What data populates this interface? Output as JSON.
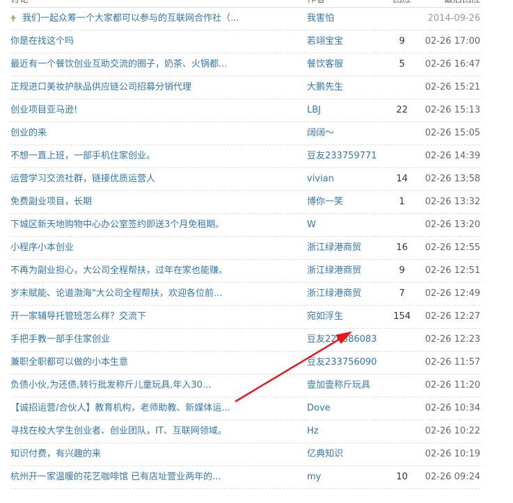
{
  "header": {
    "col_title": "讨论",
    "col_author": "作者",
    "col_reply": "回应",
    "col_time": "最后回应"
  },
  "topics": [
    {
      "title": "我们一起众筹一个大家都可以参与的互联网合作社（...",
      "author": "我害怕",
      "replies": "",
      "time": "2014-09-26",
      "pinned": true
    },
    {
      "title": "你是在找这个吗",
      "author": "若翊宝宝",
      "replies": "9",
      "time": "02-26 17:00"
    },
    {
      "title": "最近有一个餐饮创业互助交流的圈子，奶茶、火锅都...",
      "author": "餐饮客服",
      "replies": "5",
      "time": "02-26 16:47"
    },
    {
      "title": "正规进口美妆护肤品供应链公司招募分销代理",
      "author": "大鹏先生",
      "replies": "",
      "time": "02-26 15:21"
    },
    {
      "title": "创业项目亚马逊!",
      "author": "LBJ",
      "replies": "22",
      "time": "02-26 15:13"
    },
    {
      "title": "创业的来",
      "author": "阔阔～",
      "replies": "",
      "time": "02-26 15:05"
    },
    {
      "title": "不想一直上班，一部手机住家创业。",
      "author": "豆友233759771",
      "replies": "",
      "time": "02-26 14:39"
    },
    {
      "title": "运营学习交流社群，链接优质运营人",
      "author": "vivian",
      "replies": "14",
      "time": "02-26 13:58"
    },
    {
      "title": "免费副业项目，长期",
      "author": "博你一笑",
      "replies": "1",
      "time": "02-26 13:32"
    },
    {
      "title": "下城区新天地购物中心办公室签约即送3个月免租期。",
      "author": "W",
      "replies": "",
      "time": "02-26 13:20"
    },
    {
      "title": "小程序小本创业",
      "author": "浙江绿港商贸",
      "replies": "16",
      "time": "02-26 12:55"
    },
    {
      "title": "不再为副业担心，大公司全程帮扶，过年在家也能赚。",
      "author": "浙江绿港商贸",
      "replies": "9",
      "time": "02-26 12:51"
    },
    {
      "title": "岁末赋能、论道渤海\"大公司全程帮扶，欢迎各位前...",
      "author": "浙江绿港商贸",
      "replies": "7",
      "time": "02-26 12:49"
    },
    {
      "title": "开一家辅导托管班怎么样？交流下",
      "author": "宛如浮生",
      "replies": "154",
      "time": "02-26 12:27"
    },
    {
      "title": "手把手教一部手住家创业",
      "author": "豆友224886083",
      "replies": "",
      "time": "02-26 12:23"
    },
    {
      "title": "兼职全职都可以做的小本生意",
      "author": "豆友233756090",
      "replies": "",
      "time": "02-26 11:57"
    },
    {
      "title": "负债小伙,为还债,转行批发称斤儿童玩具,年入30...",
      "author": "壹加壹称斤玩具",
      "replies": "",
      "time": "02-26 11:20"
    },
    {
      "title": "【诚招运营/合伙人】教育机构，老师助教、新媒体运...",
      "author": "Dove",
      "replies": "",
      "time": "02-26 10:34"
    },
    {
      "title": "寻找在校大学生创业者、创业团队，IT、互联网领域。",
      "author": "Hz",
      "replies": "",
      "time": "02-26 10:22"
    },
    {
      "title": "知识付费，有兴趣的来",
      "author": "亿典知识",
      "replies": "",
      "time": "02-26 10:19"
    },
    {
      "title": "杭州开一家温暖的花艺咖啡馆 已有店址营业两年的...",
      "author": "my",
      "replies": "10",
      "time": "02-26 09:24"
    }
  ],
  "annotation": {
    "arrow_color": "#e8161b"
  }
}
